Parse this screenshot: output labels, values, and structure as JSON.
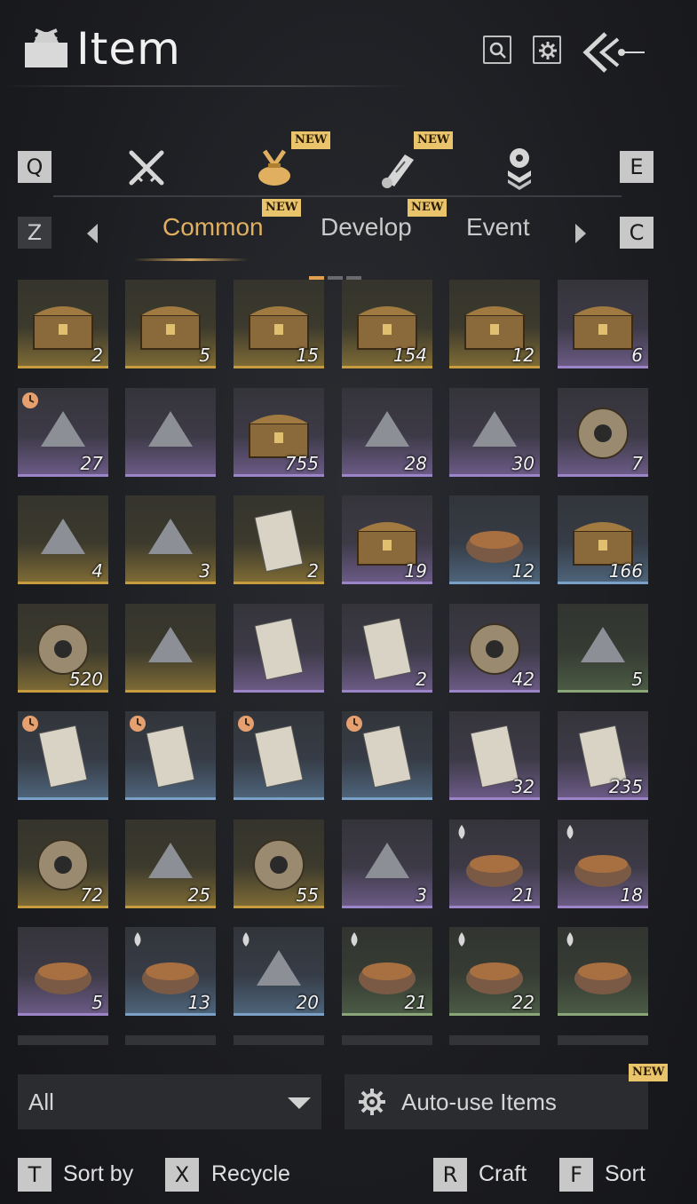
{
  "header": {
    "title": "Item",
    "icons": [
      "search-icon",
      "gear-icon",
      "back-icon"
    ]
  },
  "category_tabs": {
    "prev_key": "Q",
    "next_key": "E",
    "items": [
      {
        "icon": "crossed-swords-icon",
        "new": false
      },
      {
        "icon": "pouch-icon",
        "new": true,
        "active": true
      },
      {
        "icon": "scroll-icon",
        "new": true
      },
      {
        "icon": "gem-stack-icon",
        "new": false
      }
    ]
  },
  "sub_tabs": {
    "prev_key": "Z",
    "next_key": "C",
    "items": [
      {
        "label": "Common",
        "new": true,
        "active": true
      },
      {
        "label": "Develop",
        "new": true
      },
      {
        "label": "Event",
        "new": false
      }
    ]
  },
  "new_label": "NEW",
  "grid": {
    "items": [
      {
        "name": "chest-heart",
        "count": "2",
        "rarity": "gold"
      },
      {
        "name": "chest-shell",
        "count": "5",
        "rarity": "gold"
      },
      {
        "name": "chest-jade",
        "count": "15",
        "rarity": "gold"
      },
      {
        "name": "chest-ore",
        "count": "154",
        "rarity": "gold"
      },
      {
        "name": "chest-armor",
        "count": "12",
        "rarity": "gold"
      },
      {
        "name": "chest-iron",
        "count": "6",
        "rarity": "purple"
      },
      {
        "name": "pearl-stand",
        "count": "27",
        "rarity": "purple",
        "timed": true
      },
      {
        "name": "gift-bundle",
        "count": "",
        "rarity": "purple"
      },
      {
        "name": "carved-box",
        "count": "755",
        "rarity": "purple"
      },
      {
        "name": "bird-chest",
        "count": "28",
        "rarity": "purple"
      },
      {
        "name": "metal-chest",
        "count": "30",
        "rarity": "purple"
      },
      {
        "name": "mountain-token",
        "count": "7",
        "rarity": "purple"
      },
      {
        "name": "mist-scroll",
        "count": "4",
        "rarity": "gold"
      },
      {
        "name": "brush-paper",
        "count": "3",
        "rarity": "gold"
      },
      {
        "name": "red-booklet",
        "count": "2",
        "rarity": "gold"
      },
      {
        "name": "gem-box",
        "count": "19",
        "rarity": "purple"
      },
      {
        "name": "porcelain-jar",
        "count": "12",
        "rarity": "blue"
      },
      {
        "name": "pigment-box",
        "count": "166",
        "rarity": "blue"
      },
      {
        "name": "jade-ring",
        "count": "520",
        "rarity": "gold"
      },
      {
        "name": "iron-tablet",
        "count": "",
        "rarity": "gold"
      },
      {
        "name": "red-tag",
        "count": "",
        "rarity": "purple"
      },
      {
        "name": "black-card",
        "count": "2",
        "rarity": "purple"
      },
      {
        "name": "dove-coin",
        "count": "42",
        "rarity": "purple"
      },
      {
        "name": "gold-flakes",
        "count": "5",
        "rarity": "green"
      },
      {
        "name": "horse-card",
        "count": "",
        "rarity": "blue",
        "timed": true
      },
      {
        "name": "dog-card",
        "count": "",
        "rarity": "blue",
        "timed": true
      },
      {
        "name": "cow-card",
        "count": "",
        "rarity": "blue",
        "timed": true
      },
      {
        "name": "goose-card",
        "count": "",
        "rarity": "blue",
        "timed": true
      },
      {
        "name": "plum-envelope",
        "count": "32",
        "rarity": "purple"
      },
      {
        "name": "flower-envelope",
        "count": "235",
        "rarity": "purple"
      },
      {
        "name": "cat-bell",
        "count": "72",
        "rarity": "gold"
      },
      {
        "name": "gold-ingot",
        "count": "25",
        "rarity": "gold"
      },
      {
        "name": "cat-coin",
        "count": "55",
        "rarity": "gold"
      },
      {
        "name": "opal-stone",
        "count": "3",
        "rarity": "purple"
      },
      {
        "name": "stew-pot",
        "count": "21",
        "rarity": "purple",
        "food": true
      },
      {
        "name": "clay-pot",
        "count": "18",
        "rarity": "purple",
        "food": true
      },
      {
        "name": "wine-jar",
        "count": "5",
        "rarity": "purple"
      },
      {
        "name": "egg-plate",
        "count": "13",
        "rarity": "blue",
        "food": true
      },
      {
        "name": "ribs",
        "count": "20",
        "rarity": "blue",
        "food": true
      },
      {
        "name": "mushroom-dish",
        "count": "21",
        "rarity": "green",
        "food": true
      },
      {
        "name": "soup-bowl",
        "count": "22",
        "rarity": "green",
        "food": true
      },
      {
        "name": "noodle-bowl",
        "count": "",
        "rarity": "green",
        "food": true
      }
    ]
  },
  "filter": {
    "selected": "All"
  },
  "auto_use": {
    "label": "Auto-use Items",
    "new": true
  },
  "footer": [
    {
      "key": "T",
      "label": "Sort by"
    },
    {
      "key": "X",
      "label": "Recycle"
    },
    {
      "key": "R",
      "label": "Craft"
    },
    {
      "key": "F",
      "label": "Sort"
    }
  ],
  "colors": {
    "accent_gold": "#e0b060",
    "new_badge": "#e9c46a",
    "rarity_gold": "#c79c3f",
    "rarity_purple": "#9b84c8",
    "rarity_blue": "#7aa0c7",
    "rarity_green": "#8aa678"
  }
}
